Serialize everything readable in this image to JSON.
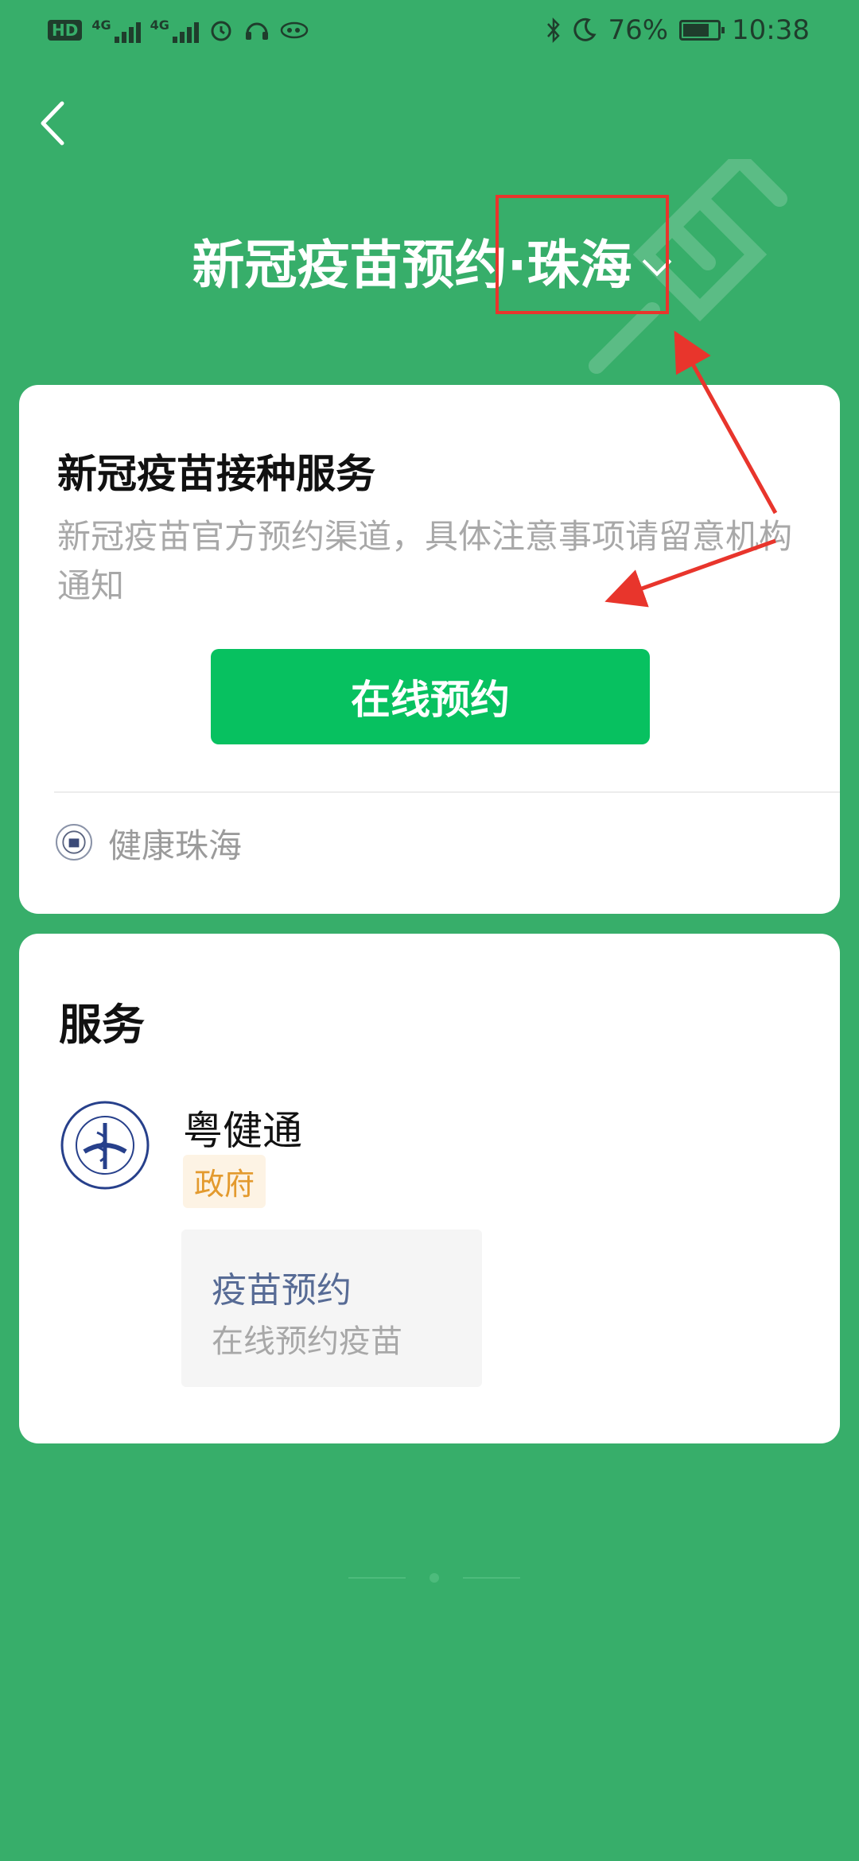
{
  "status_bar": {
    "hd": "HD",
    "net1": "4G",
    "net2": "4G",
    "battery_percent": "76%",
    "battery_level": 0.76,
    "time": "10:38"
  },
  "header": {
    "title": "新冠疫苗预约",
    "city": "·珠海"
  },
  "vaccine_card": {
    "title": "新冠疫苗接种服务",
    "description": "新冠疫苗官方预约渠道，具体注意事项请留意机构通知",
    "button_label": "在线预约",
    "source_name": "健康珠海"
  },
  "services_card": {
    "title": "服务",
    "provider_name": "粤健通",
    "provider_tag": "政府",
    "service_title": "疫苗预约",
    "service_subtitle": "在线预约疫苗"
  },
  "colors": {
    "background": "#37ae6a",
    "primary_button": "#07c160",
    "annotation": "#e8352c",
    "tag_text": "#e39a2e",
    "link_text": "#576b95"
  }
}
